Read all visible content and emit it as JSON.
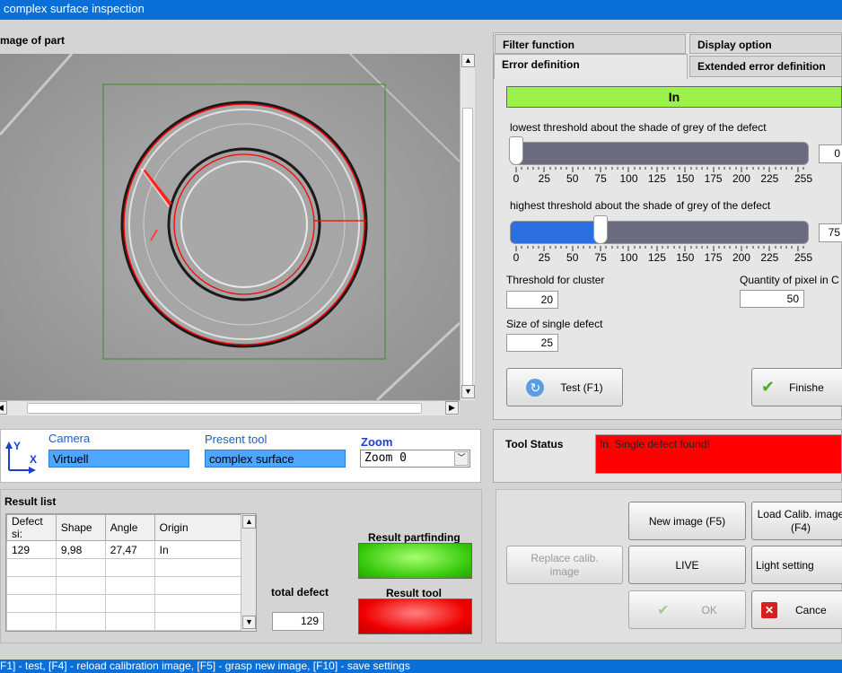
{
  "window": {
    "title": "complex surface inspection"
  },
  "image_panel": {
    "label": "mage of part"
  },
  "camera": {
    "label": "Camera",
    "value": "Virtuell"
  },
  "present_tool": {
    "label": "Present tool",
    "value": "complex surface"
  },
  "zoom": {
    "label": "Zoom",
    "value": "Zoom 0"
  },
  "axes": {
    "y": "Y",
    "x": "X"
  },
  "tabs": {
    "filter": "Filter function",
    "display": "Display option",
    "error": "Error definition",
    "extended": "Extended error definition"
  },
  "status_in": "In",
  "slider_low": {
    "label": "lowest threshold about the shade of grey of the defect",
    "value_display": "0",
    "value": 0
  },
  "slider_high": {
    "label": "highest threshold about the shade of grey of the defect",
    "value_display": "75",
    "value": 75
  },
  "ticks": [
    "0",
    "25",
    "50",
    "75",
    "100",
    "125",
    "150",
    "175",
    "200",
    "225",
    "255"
  ],
  "cluster": {
    "label": "Threshold for cluster",
    "value": "20"
  },
  "quantity": {
    "label": "Quantity of pixel in C",
    "value": "50"
  },
  "single": {
    "label": "Size of single defect",
    "value": "25"
  },
  "buttons": {
    "test": "Test (F1)",
    "finish": "Finishe",
    "new_image": "New image (F5)",
    "load_calib": "Load Calib. image (F4)",
    "replace_calib": "Replace calib. image",
    "live": "LIVE",
    "light": "Light setting",
    "ok": "OK",
    "cancel": "Cance"
  },
  "tool_status": {
    "label": "Tool Status",
    "text": "In. Single defect found!"
  },
  "result_list": {
    "label": "Result list",
    "headers": [
      "Defect si:",
      "Shape",
      "Angle",
      "Origin"
    ],
    "rows": [
      [
        "129",
        "9,98",
        "27,47",
        "In"
      ]
    ]
  },
  "result_partfinding": "Result partfinding",
  "result_tool": "Result tool",
  "total_defect": {
    "label": "total defect",
    "value": "129"
  },
  "status_bar": "F1] - test, [F4] - reload calibration image, [F5] - grasp new image, [F10] - save settings",
  "colors": {
    "title_blue": "#0a6fd6",
    "green": "#9bf24a",
    "red": "#ff0000",
    "slider_blue": "#2c6fe0"
  }
}
